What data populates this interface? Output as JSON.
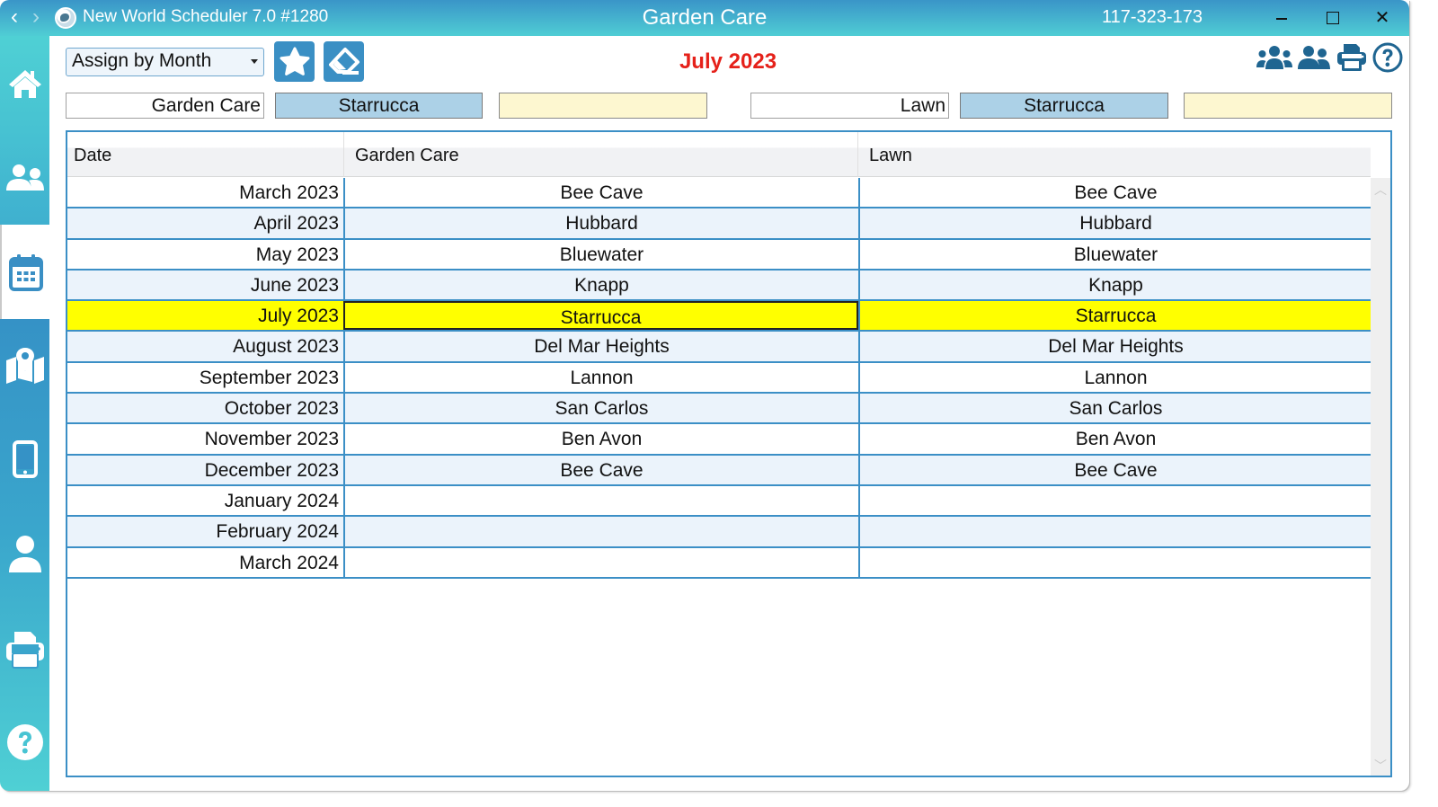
{
  "titlebar": {
    "back_icon": "chevron-left-icon",
    "forward_icon": "chevron-right-icon",
    "app_name": "New World Scheduler 7.0 #1280",
    "title": "Garden Care",
    "code": "117-323-173",
    "minimize_icon": "minimize-icon",
    "maximize_icon": "maximize-icon",
    "close_label": "✕"
  },
  "sidebar": {
    "items": [
      {
        "id": "home",
        "icon": "home-icon"
      },
      {
        "id": "people",
        "icon": "people-icon"
      },
      {
        "id": "calendar",
        "icon": "calendar-icon",
        "active": true
      },
      {
        "id": "map",
        "icon": "map-marker-icon"
      },
      {
        "id": "mobile",
        "icon": "mobile-icon"
      },
      {
        "id": "user",
        "icon": "user-icon"
      },
      {
        "id": "print",
        "icon": "printer-icon"
      },
      {
        "id": "help",
        "icon": "help-icon"
      }
    ]
  },
  "toolbar": {
    "assign_mode": "Assign by Month",
    "star_icon": "star-icon",
    "eraser_icon": "eraser-icon",
    "month": "July 2023",
    "right_icons": [
      "group-icon",
      "people-icon",
      "printer-icon",
      "help-icon"
    ]
  },
  "filters": {
    "left": {
      "label": "Garden Care",
      "selected": "Starrucca",
      "extra": ""
    },
    "right": {
      "label": "Lawn",
      "selected": "Starrucca",
      "extra": ""
    }
  },
  "grid": {
    "columns": [
      "Date",
      "Garden Care",
      "Lawn"
    ],
    "rows": [
      {
        "date": "March 2023",
        "garden": "Bee Cave",
        "lawn": "Bee Cave"
      },
      {
        "date": "April 2023",
        "garden": "Hubbard",
        "lawn": "Hubbard"
      },
      {
        "date": "May 2023",
        "garden": "Bluewater",
        "lawn": "Bluewater"
      },
      {
        "date": "June 2023",
        "garden": "Knapp",
        "lawn": "Knapp"
      },
      {
        "date": "July 2023",
        "garden": "Starrucca",
        "lawn": "Starrucca",
        "highlighted": true
      },
      {
        "date": "August 2023",
        "garden": "Del Mar Heights",
        "lawn": "Del Mar Heights"
      },
      {
        "date": "September 2023",
        "garden": "Lannon",
        "lawn": "Lannon"
      },
      {
        "date": "October 2023",
        "garden": "San Carlos",
        "lawn": "San Carlos"
      },
      {
        "date": "November 2023",
        "garden": "Ben Avon",
        "lawn": "Ben Avon"
      },
      {
        "date": "December 2023",
        "garden": "Bee Cave",
        "lawn": "Bee Cave"
      },
      {
        "date": "January 2024",
        "garden": "",
        "lawn": ""
      },
      {
        "date": "February 2024",
        "garden": "",
        "lawn": ""
      },
      {
        "date": "March 2024",
        "garden": "",
        "lawn": ""
      }
    ]
  },
  "colors": {
    "accent": "#3a8fc4",
    "month_title": "#e5211a",
    "highlight_row": "#ffff00",
    "selected_box": "#acd1e7",
    "yellow_box": "#fdf7d0",
    "alt_row": "#ebf3fb",
    "icon_dark": "#1f6591"
  }
}
